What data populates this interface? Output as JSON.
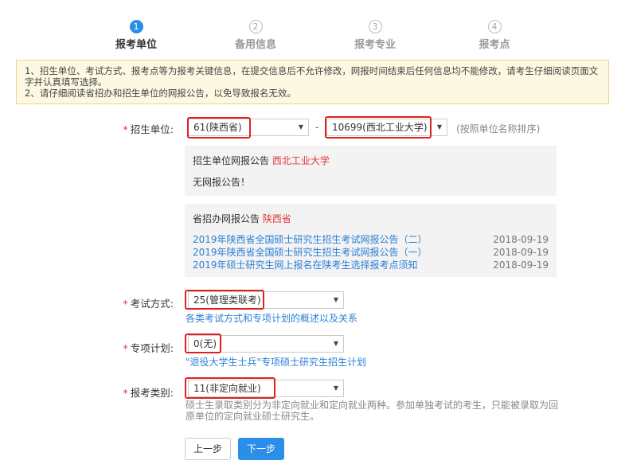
{
  "steps": [
    {
      "num": "1",
      "label": "报考单位"
    },
    {
      "num": "2",
      "label": "备用信息"
    },
    {
      "num": "3",
      "label": "报考专业"
    },
    {
      "num": "4",
      "label": "报考点"
    }
  ],
  "notice": {
    "line1": "1、招生单位、考试方式、报考点等为报考关键信息，在提交信息后不允许修改，网报时间结束后任何信息均不能修改，请考生仔细阅读页面文字并认真填写选择。",
    "line2": "2、请仔细阅读省招办和招生单位的网报公告，以免导致报名无效。"
  },
  "form": {
    "unit": {
      "label": "招生单位:",
      "province_value": "61(陕西省)",
      "dash": "-",
      "school_value": "10699(西北工业大学)",
      "hint": "(按照单位名称排序)"
    },
    "unit_panel": {
      "title": "招生单位网报公告",
      "school": "西北工业大学",
      "body": "无网报公告！"
    },
    "province_panel": {
      "title": "省招办网报公告",
      "province": "陕西省",
      "items": [
        {
          "text": "2019年陕西省全国硕士研究生招生考试网报公告（二）",
          "date": "2018-09-19"
        },
        {
          "text": "2019年陕西省全国硕士研究生招生考试网报公告（一）",
          "date": "2018-09-19"
        },
        {
          "text": "2019年硕士研究生网上报名在陕考生选择报考点须知",
          "date": "2018-09-19"
        }
      ]
    },
    "exam_method": {
      "label": "考试方式:",
      "value": "25(管理类联考)",
      "link": "各类考试方式和专项计划的概述以及关系"
    },
    "special_plan": {
      "label": "专项计划:",
      "value": "0(无)",
      "link": "\"退役大学生士兵\"专项硕士研究生招生计划"
    },
    "category": {
      "label": "报考类别:",
      "value": "11(非定向就业)",
      "desc": "硕士生录取类别分为非定向就业和定向就业两种。参加单独考试的考生，只能被录取为回原单位的定向就业硕士研究生。"
    }
  },
  "buttons": {
    "prev": "上一步",
    "next": "下一步"
  }
}
